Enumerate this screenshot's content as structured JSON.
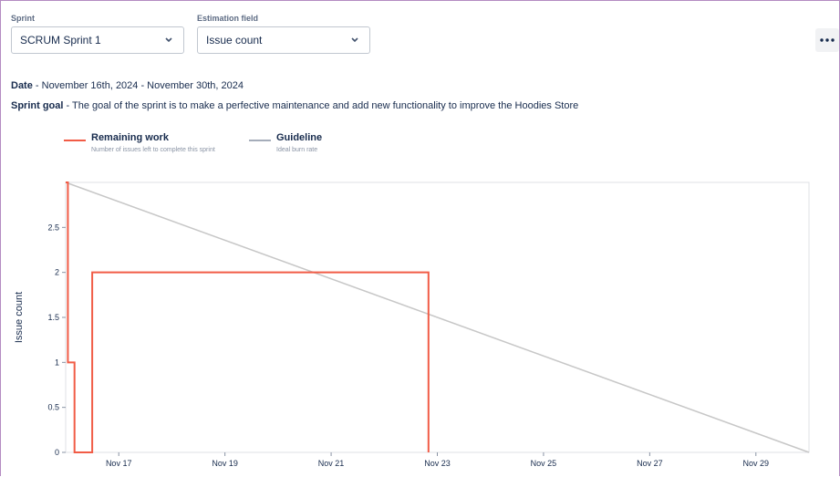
{
  "filters": {
    "sprint": {
      "label": "Sprint",
      "value": "SCRUM Sprint 1"
    },
    "estimation": {
      "label": "Estimation field",
      "value": "Issue count"
    }
  },
  "more_icon": "ellipsis-icon",
  "info": {
    "date_label": "Date",
    "date_value": " - November 16th, 2024 - November 30th, 2024",
    "goal_label": "Sprint goal",
    "goal_value": " - The goal of the sprint is to make a perfective maintenance and add new functionality to improve the Hoodies Store"
  },
  "legend": [
    {
      "title": "Remaining work",
      "desc": "Number of issues left to complete this sprint",
      "color": "#f15c46"
    },
    {
      "title": "Guideline",
      "desc": "Ideal burn rate",
      "color": "#a5adba"
    }
  ],
  "chart_data": {
    "type": "line",
    "ylabel": "Issue count",
    "xlabel": "",
    "y_ticks": [
      "0",
      "0.5",
      "1",
      "1.5",
      "2",
      "2.5"
    ],
    "x_ticks": [
      "Nov 17",
      "Nov 19",
      "Nov 21",
      "Nov 23",
      "Nov 25",
      "Nov 27",
      "Nov 29"
    ],
    "ylim": [
      0,
      3
    ],
    "xlim": [
      "2024-11-16",
      "2024-11-30"
    ],
    "grid": false,
    "series": [
      {
        "name": "Remaining work",
        "color": "#f15c46",
        "points": [
          [
            "2024-11-16T00:00",
            3
          ],
          [
            "2024-11-16T01:00",
            3
          ],
          [
            "2024-11-16T01:00",
            1
          ],
          [
            "2024-11-16T04:00",
            1
          ],
          [
            "2024-11-16T04:00",
            0
          ],
          [
            "2024-11-16T12:00",
            0
          ],
          [
            "2024-11-16T12:00",
            2
          ],
          [
            "2024-11-22T20:00",
            2
          ],
          [
            "2024-11-22T20:00",
            0
          ]
        ]
      },
      {
        "name": "Guideline",
        "color": "#c7c7c7",
        "points": [
          [
            "2024-11-16T00:00",
            3
          ],
          [
            "2024-11-30T00:00",
            0
          ]
        ]
      }
    ]
  }
}
